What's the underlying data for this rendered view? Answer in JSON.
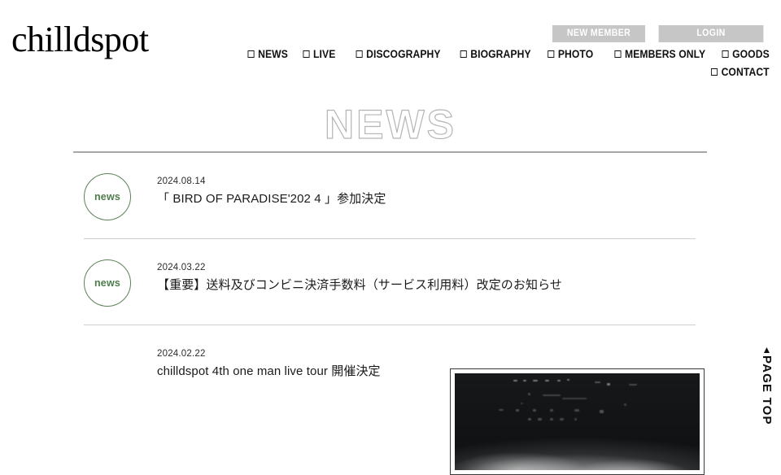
{
  "site": {
    "brand": "chilldspot"
  },
  "header": {
    "account_buttons": [
      {
        "label": "NEW MEMBER",
        "name": "new-member-button"
      },
      {
        "label": "LOGIN",
        "name": "login-button"
      }
    ],
    "nav_items": [
      {
        "label": "NEWS"
      },
      {
        "label": "LIVE"
      },
      {
        "label": "DISCOGRAPHY"
      },
      {
        "label": "BIOGRAPHY"
      },
      {
        "label": "PHOTO"
      },
      {
        "label": "MEMBERS ONLY"
      },
      {
        "label": "GOODS"
      },
      {
        "label": "CONTACT"
      }
    ],
    "nav_icon": "checkbox-square-icon"
  },
  "main": {
    "page_title": "NEWS",
    "news_items": [
      {
        "badge": "news",
        "date": "2024.08.14",
        "title": "「 BIRD OF PARADISE'202 4 」参加決定"
      },
      {
        "badge": "news",
        "date": "2024.03.22",
        "title": "【重要】送料及びコンビニ決済手数料（サービス利用料）改定のお知らせ"
      },
      {
        "badge": "",
        "date": "2024.02.22",
        "title": "chilldspot 4th one man live tour 開催決定"
      }
    ]
  },
  "page_top": {
    "arrow": "▲",
    "label": "PAGE TOP"
  },
  "colors": {
    "badge_green": "#4e7d4c",
    "account_button_bg": "#c6c6c6",
    "title_outline": "#b5b5b5",
    "rule": "#a7a7a7",
    "row_divider": "#cfcfcf"
  }
}
